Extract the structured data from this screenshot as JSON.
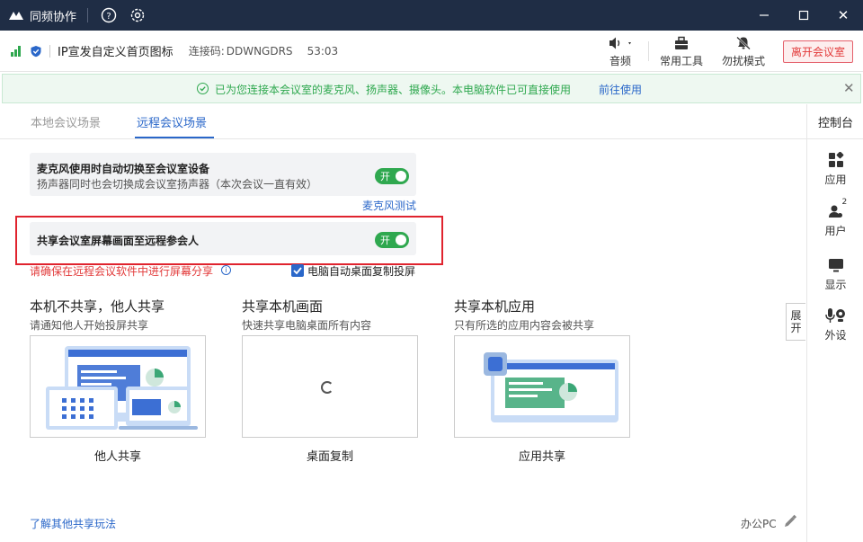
{
  "titlebar": {
    "app_name": "同频协作",
    "help_glyph": "?",
    "close_glyph": "✕"
  },
  "meeting": {
    "name": "IP宣发自定义首页图标",
    "conn_label": "连接码:",
    "conn_code": "DDWNGDRS",
    "duration": "53:03"
  },
  "toolbar": {
    "audio": "音频",
    "tools": "常用工具",
    "dnd": "勿扰模式",
    "leave": "离开会议室"
  },
  "notice": {
    "text": "已为您连接本会议室的麦克风、扬声器、摄像头。本电脑软件已可直接使用",
    "link": "前往使用",
    "close_glyph": "✕"
  },
  "tabs": [
    {
      "label": "本地会议场景"
    },
    {
      "label": "远程会议场景"
    }
  ],
  "sidebar": {
    "title": "控制台",
    "items": [
      {
        "label": "应用"
      },
      {
        "label": "用户",
        "badge": "2"
      },
      {
        "label": "显示"
      },
      {
        "label": "外设"
      }
    ]
  },
  "settings": {
    "mic_switch_title": "麦克风使用时自动切换至会议室设备",
    "mic_switch_sub": "扬声器同时也会切换成会议室扬声器（本次会议一直有效）",
    "toggle_on": "开",
    "mic_test": "麦克风测试",
    "share_title": "共享会议室屏幕画面至远程参会人",
    "warning": "请确保在远程会议软件中进行屏幕分享",
    "info_glyph": "i",
    "auto_copy": "电脑自动桌面复制投屏"
  },
  "share_options": [
    {
      "title": "本机不共享，他人共享",
      "sub": "请通知他人开始投屏共享",
      "caption": "他人共享"
    },
    {
      "title": "共享本机画面",
      "sub": "快速共享电脑桌面所有内容",
      "caption": "桌面复制"
    },
    {
      "title": "共享本机应用",
      "sub": "只有所选的应用内容会被共享",
      "caption": "应用共享"
    }
  ],
  "expand": {
    "line1": "展",
    "line2": "开"
  },
  "footer": {
    "learn_more": "了解其他共享玩法",
    "device": "办公PC"
  },
  "colors": {
    "accent": "#2a67c9",
    "success": "#2fa84f",
    "danger": "#e0232e",
    "titlebar": "#1f2d45"
  }
}
